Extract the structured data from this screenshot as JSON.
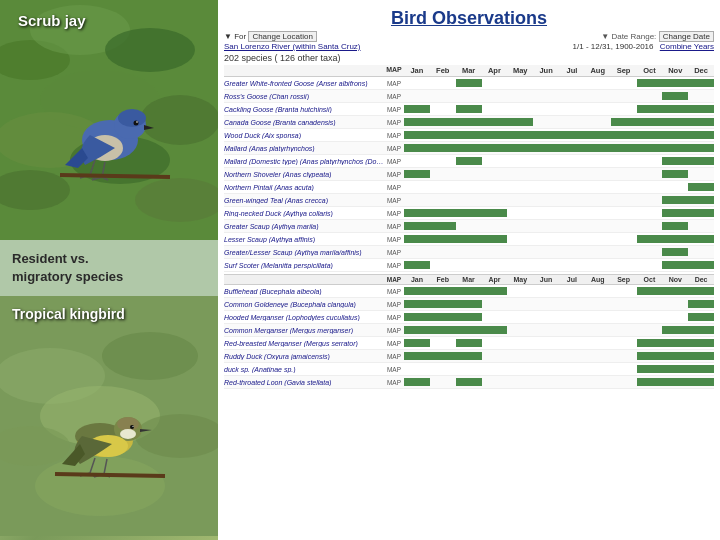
{
  "left_panel": {
    "top_photo_label": "Scrub jay",
    "middle_text_line1": "Resident vs.",
    "middle_text_line2": "migratory species",
    "bottom_photo_label": "Tropical kingbird"
  },
  "right_panel": {
    "title": "Bird Observations",
    "date_range_label": "▼ Date Range:",
    "change_date_btn": "Change Date",
    "date_values": "1/1 - 12/31, 1900-2016",
    "combine_years": "Combine Years",
    "for_label": "▼ For",
    "change_location_btn": "Change Location",
    "location": "San Lorenzo River (within Santa Cruz)",
    "species_count": "202 species ( 126 other taxa)",
    "months": [
      "Jan",
      "Feb",
      "Mar",
      "Apr",
      "May",
      "Jun",
      "Jul",
      "Aug",
      "Sep",
      "Oct",
      "Nov",
      "Dec"
    ],
    "species": [
      {
        "name": "Greater White-fronted Goose (Anser albifrons)",
        "map": true,
        "bars": [
          0,
          0,
          1,
          0,
          0,
          0,
          0,
          0,
          0,
          1,
          1,
          1
        ]
      },
      {
        "name": "Ross's Goose (Chan rossii)",
        "map": true,
        "bars": [
          0,
          0,
          0,
          0,
          0,
          0,
          0,
          0,
          0,
          0,
          1,
          0
        ]
      },
      {
        "name": "Cackling Goose (Branta hutchinsii)",
        "map": true,
        "bars": [
          1,
          0,
          1,
          0,
          0,
          0,
          0,
          0,
          0,
          1,
          1,
          1
        ]
      },
      {
        "name": "Canada Goose (Branta canadensis)",
        "map": true,
        "bars": [
          1,
          1,
          1,
          1,
          1,
          0,
          0,
          0,
          1,
          1,
          1,
          1
        ]
      },
      {
        "name": "Wood Duck (Aix sponsa)",
        "map": true,
        "bars": [
          1,
          1,
          1,
          1,
          1,
          1,
          1,
          1,
          1,
          1,
          1,
          1
        ]
      },
      {
        "name": "Mallard (Anas platyrhynchos)",
        "map": true,
        "bars": [
          1,
          1,
          1,
          1,
          1,
          1,
          1,
          1,
          1,
          1,
          1,
          1
        ]
      },
      {
        "name": "Mallard (Domestic type) (Anas platyrhynchos (Domestic type))",
        "map": true,
        "bars": [
          0,
          0,
          1,
          0,
          0,
          0,
          0,
          0,
          0,
          0,
          1,
          1
        ]
      },
      {
        "name": "Northern Shoveler (Anas clypeata)",
        "map": true,
        "bars": [
          1,
          0,
          0,
          0,
          0,
          0,
          0,
          0,
          0,
          0,
          1,
          0
        ]
      },
      {
        "name": "Northern Pintail (Anas acuta)",
        "map": true,
        "bars": [
          0,
          0,
          0,
          0,
          0,
          0,
          0,
          0,
          0,
          0,
          0,
          1
        ]
      },
      {
        "name": "Green-winged Teal (Anas crecca)",
        "map": true,
        "bars": [
          0,
          0,
          0,
          0,
          0,
          0,
          0,
          0,
          0,
          0,
          1,
          1
        ]
      },
      {
        "name": "Ring-necked Duck (Aythya collaris)",
        "map": true,
        "bars": [
          1,
          1,
          1,
          1,
          0,
          0,
          0,
          0,
          0,
          0,
          1,
          1
        ]
      },
      {
        "name": "Greater Scaup (Aythya marila)",
        "map": true,
        "bars": [
          1,
          1,
          0,
          0,
          0,
          0,
          0,
          0,
          0,
          0,
          1,
          0
        ]
      },
      {
        "name": "Lesser Scaup (Aythya affinis)",
        "map": true,
        "bars": [
          1,
          1,
          1,
          1,
          0,
          0,
          0,
          0,
          0,
          1,
          1,
          1
        ]
      },
      {
        "name": "Greater/Lesser Scaup (Aythya marila/affinis)",
        "map": true,
        "bars": [
          0,
          0,
          0,
          0,
          0,
          0,
          0,
          0,
          0,
          0,
          1,
          0
        ]
      },
      {
        "name": "Surf Scoter (Melanitta perspicillata)",
        "map": true,
        "bars": [
          1,
          0,
          0,
          0,
          0,
          0,
          0,
          0,
          0,
          0,
          1,
          1
        ]
      },
      {
        "name": "Bufflehead (Bucephala albeola)",
        "map": true,
        "bars": [
          1,
          1,
          1,
          1,
          0,
          0,
          0,
          0,
          0,
          1,
          1,
          1
        ]
      },
      {
        "name": "Common Goldeneye (Bucephala clangula)",
        "map": true,
        "bars": [
          1,
          1,
          1,
          0,
          0,
          0,
          0,
          0,
          0,
          0,
          0,
          1
        ]
      },
      {
        "name": "Hooded Merganser (Lophodytes cucullatus)",
        "map": true,
        "bars": [
          1,
          1,
          1,
          0,
          0,
          0,
          0,
          0,
          0,
          0,
          0,
          1
        ]
      },
      {
        "name": "Common Merganser (Mergus merganser)",
        "map": true,
        "bars": [
          1,
          1,
          1,
          1,
          0,
          0,
          0,
          0,
          0,
          0,
          1,
          1
        ]
      },
      {
        "name": "Red-breasted Merganser (Mergus serrator)",
        "map": true,
        "bars": [
          1,
          0,
          1,
          0,
          0,
          0,
          0,
          0,
          0,
          1,
          1,
          1
        ]
      },
      {
        "name": "Ruddy Duck (Oxyura jamaicensis)",
        "map": true,
        "bars": [
          1,
          1,
          1,
          0,
          0,
          0,
          0,
          0,
          0,
          1,
          1,
          1
        ]
      },
      {
        "name": "duck sp. (Anatinae sp.)",
        "map": true,
        "bars": [
          0,
          0,
          0,
          0,
          0,
          0,
          0,
          0,
          0,
          1,
          1,
          1
        ]
      },
      {
        "name": "Red-throated Loon (Gavia stellata)",
        "map": true,
        "bars": [
          1,
          0,
          1,
          0,
          0,
          0,
          0,
          0,
          0,
          1,
          1,
          1
        ]
      }
    ]
  }
}
